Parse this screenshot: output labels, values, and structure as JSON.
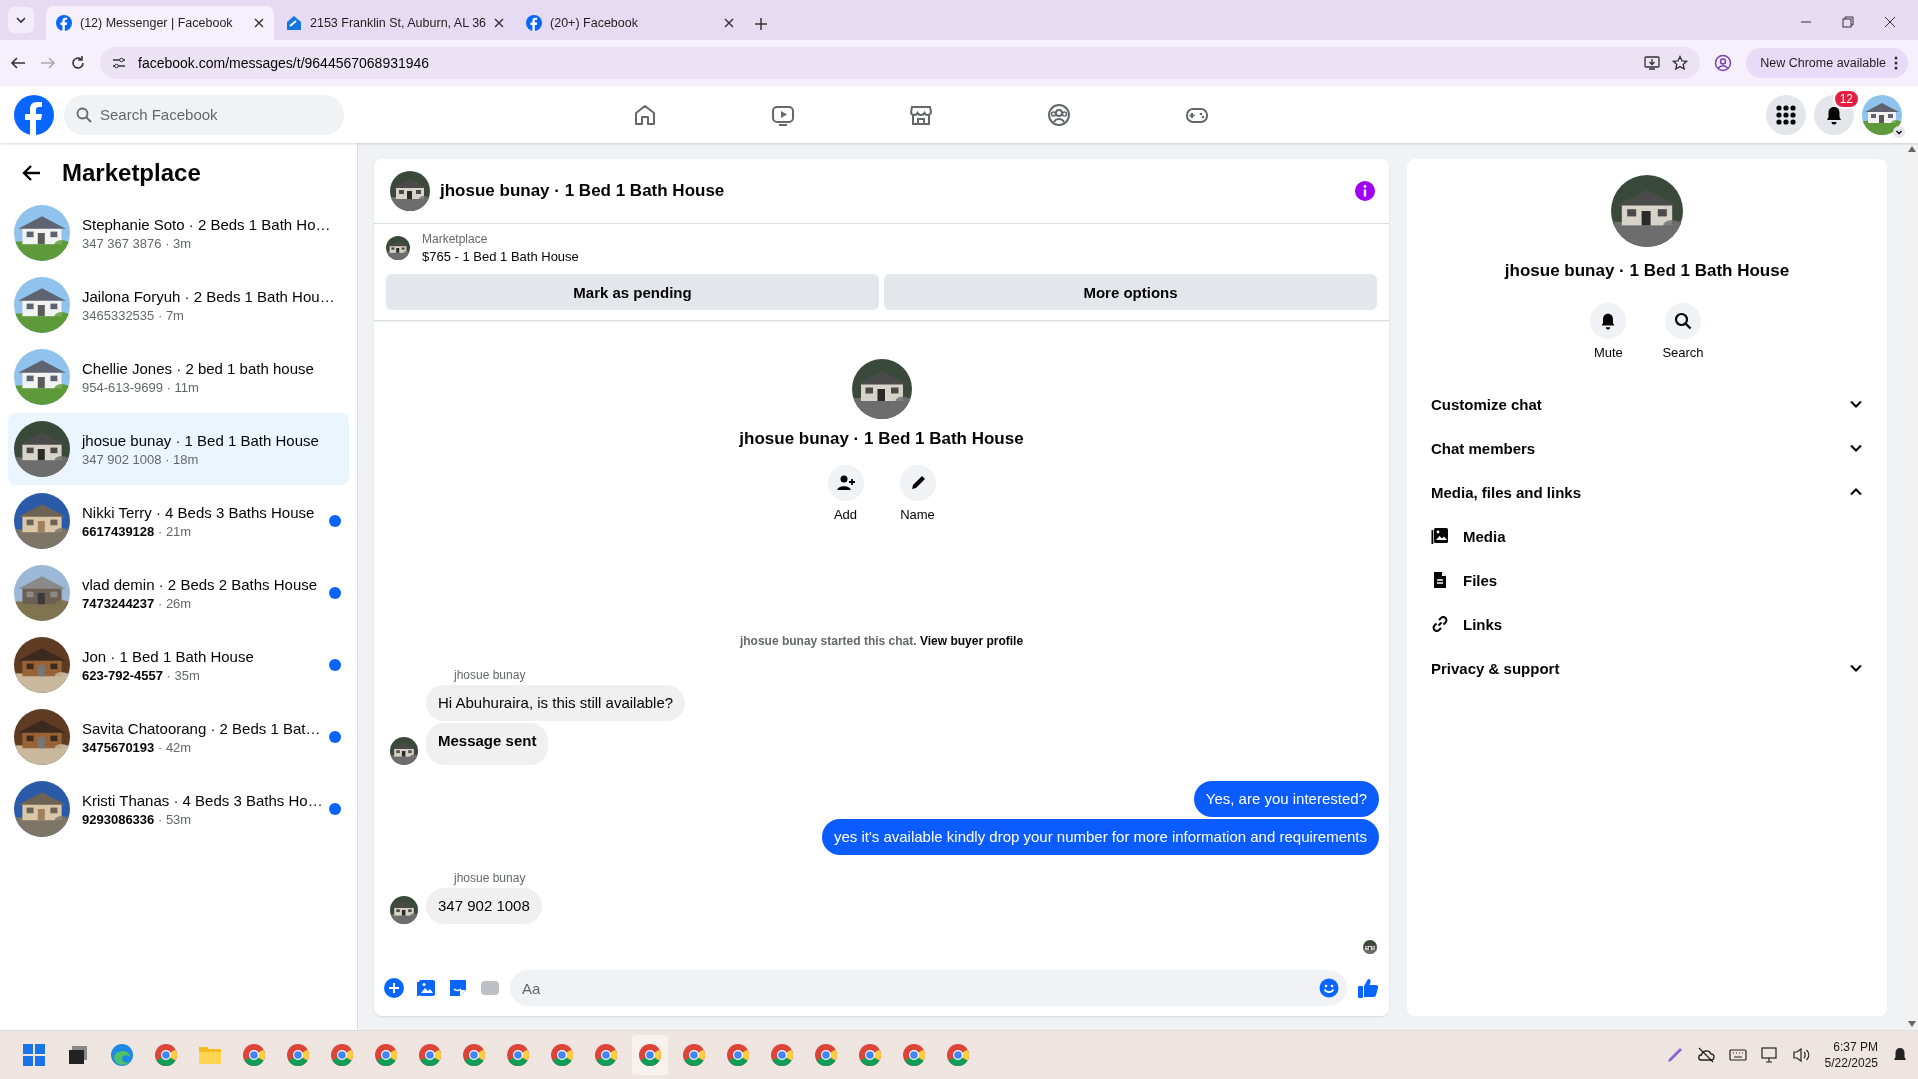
{
  "browser": {
    "tabs": [
      {
        "title": "(12) Messenger | Facebook",
        "kind": "facebook",
        "selected": true
      },
      {
        "title": "2153 Franklin St, Auburn, AL 36",
        "kind": "zillow",
        "selected": false
      },
      {
        "title": "(20+) Facebook",
        "kind": "facebook",
        "selected": false
      }
    ],
    "url": "facebook.com/messages/t/9644567068931946",
    "update_button": "New Chrome available"
  },
  "topnav": {
    "search_placeholder": "Search Facebook",
    "notification_count": "12"
  },
  "sidebar": {
    "title": "Marketplace",
    "conversations": [
      {
        "title": "Stephanie Soto · 2 Beds 1 Bath Ho…",
        "phone": "347 367 3876",
        "time": "· 3m",
        "unread": false,
        "selected": false
      },
      {
        "title": "Jailona Foryuh · 2 Beds 1 Bath Hou…",
        "phone": "3465332535",
        "time": "· 7m",
        "unread": false,
        "selected": false
      },
      {
        "title": "Chellie Jones · 2 bed 1 bath house",
        "phone": "954-613-9699",
        "time": "· 11m",
        "unread": false,
        "selected": false
      },
      {
        "title": "jhosue bunay · 1 Bed 1 Bath House",
        "phone": "347 902 1008",
        "time": "· 18m",
        "unread": false,
        "selected": true
      },
      {
        "title": "Nikki Terry · 4 Beds 3 Baths House",
        "phone": "6617439128",
        "time": "· 21m",
        "unread": true,
        "selected": false
      },
      {
        "title": "vlad demin · 2 Beds 2 Baths House",
        "phone": "7473244237",
        "time": "· 26m",
        "unread": true,
        "selected": false
      },
      {
        "title": "Jon · 1 Bed 1 Bath House",
        "phone": "623-792-4557",
        "time": "· 35m",
        "unread": true,
        "selected": false
      },
      {
        "title": "Savita Chatoorang · 2 Beds 1 Bat…",
        "phone": "3475670193",
        "time": "· 42m",
        "unread": true,
        "selected": false
      },
      {
        "title": "Kristi Thanas · 4 Beds 3 Baths Ho…",
        "phone": "9293086336",
        "time": "· 53m",
        "unread": true,
        "selected": false
      }
    ]
  },
  "chat": {
    "title": "jhosue bunay · 1 Bed 1 Bath House",
    "listing": {
      "source": "Marketplace",
      "summary": "$765 - 1 Bed 1 Bath House"
    },
    "actions": [
      "Mark as pending",
      "More options"
    ],
    "profile": {
      "name": "jhosue bunay · 1 Bed 1 Bath House",
      "actions": [
        {
          "label": "Add",
          "kind": "add"
        },
        {
          "label": "Name",
          "kind": "edit"
        }
      ]
    },
    "system_note": {
      "text": "jhosue bunay started this chat.",
      "link": "View buyer profile"
    },
    "groups": [
      {
        "outgoing": false,
        "sender": "jhosue bunay",
        "messages": [
          {
            "text": "Hi Abuhuraira, is this still available?",
            "bold": false
          },
          {
            "text": "Message sent",
            "bold": true
          }
        ]
      },
      {
        "outgoing": true,
        "messages": [
          {
            "text": "Yes, are you interested?",
            "bold": false
          },
          {
            "text": "yes it's available kindly drop your number for more information and requirements",
            "bold": false
          }
        ]
      },
      {
        "outgoing": false,
        "sender": "jhosue bunay",
        "messages": [
          {
            "text": "347 902 1008",
            "bold": false
          }
        ]
      }
    ],
    "seen": true,
    "composer": {
      "placeholder": "Aa"
    }
  },
  "details": {
    "name": "jhosue bunay · 1 Bed 1 Bath House",
    "actions": [
      {
        "label": "Mute",
        "kind": "bell"
      },
      {
        "label": "Search",
        "kind": "search"
      }
    ],
    "sections": [
      {
        "label": "Customize chat",
        "expanded": false
      },
      {
        "label": "Chat members",
        "expanded": false
      },
      {
        "label": "Media, files and links",
        "expanded": true,
        "children": [
          {
            "label": "Media",
            "kind": "media"
          },
          {
            "label": "Files",
            "kind": "files"
          },
          {
            "label": "Links",
            "kind": "links"
          }
        ]
      },
      {
        "label": "Privacy & support",
        "expanded": false
      }
    ]
  },
  "taskbar": {
    "time": "6:37 PM",
    "date": "5/22/2025"
  }
}
